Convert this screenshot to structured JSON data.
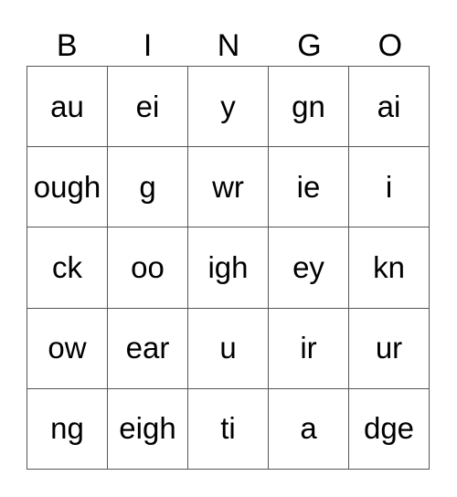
{
  "header": [
    "B",
    "I",
    "N",
    "G",
    "O"
  ],
  "cells": [
    [
      "au",
      "ei",
      "y",
      "gn",
      "ai"
    ],
    [
      "ough",
      "g",
      "wr",
      "ie",
      "i"
    ],
    [
      "ck",
      "oo",
      "igh",
      "ey",
      "kn"
    ],
    [
      "ow",
      "ear",
      "u",
      "ir",
      "ur"
    ],
    [
      "ng",
      "eigh",
      "ti",
      "a",
      "dge"
    ]
  ]
}
